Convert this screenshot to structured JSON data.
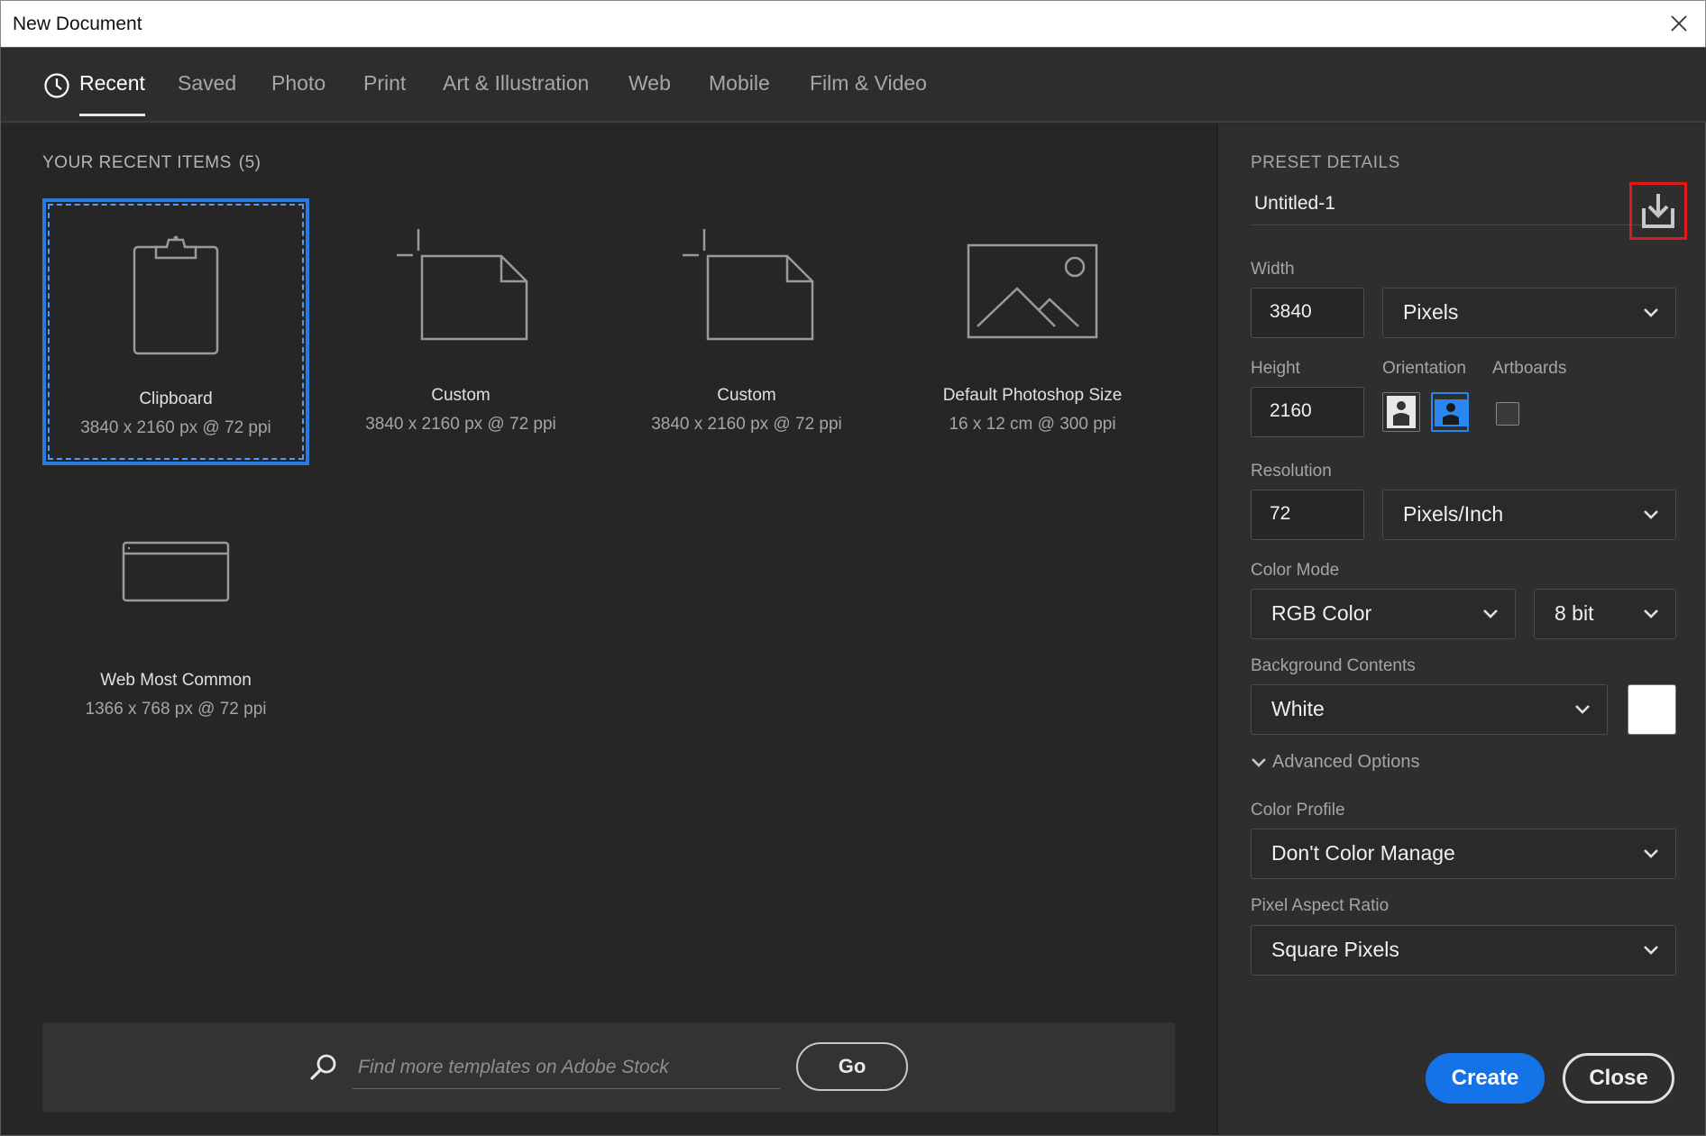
{
  "window": {
    "title": "New Document"
  },
  "tabs": [
    {
      "label": "Recent",
      "active": true
    },
    {
      "label": "Saved"
    },
    {
      "label": "Photo"
    },
    {
      "label": "Print"
    },
    {
      "label": "Art & Illustration"
    },
    {
      "label": "Web"
    },
    {
      "label": "Mobile"
    },
    {
      "label": "Film & Video"
    }
  ],
  "recent": {
    "title": "YOUR RECENT ITEMS",
    "count": "(5)",
    "items": [
      {
        "name": "Clipboard",
        "size": "3840 x 2160 px @ 72 ppi",
        "icon": "clipboard-icon",
        "selected": true
      },
      {
        "name": "Custom",
        "size": "3840 x 2160 px @ 72 ppi",
        "icon": "custom-doc-icon"
      },
      {
        "name": "Custom",
        "size": "3840 x 2160 px @ 72 ppi",
        "icon": "custom-doc-icon"
      },
      {
        "name": "Default Photoshop Size",
        "size": "16 x 12 cm @ 300 ppi",
        "icon": "image-icon"
      },
      {
        "name": "Web Most Common",
        "size": "1366 x 768 px @ 72 ppi",
        "icon": "browser-window-icon"
      }
    ]
  },
  "search": {
    "placeholder": "Find more templates on Adobe Stock",
    "go_label": "Go"
  },
  "preset": {
    "title": "PRESET DETAILS",
    "name": "Untitled-1",
    "width_label": "Width",
    "width": "3840",
    "width_unit": "Pixels",
    "height_label": "Height",
    "height": "2160",
    "orientation_label": "Orientation",
    "artboards_label": "Artboards",
    "resolution_label": "Resolution",
    "resolution": "72",
    "resolution_unit": "Pixels/Inch",
    "color_mode_label": "Color Mode",
    "color_mode": "RGB Color",
    "bit_depth": "8 bit",
    "background_label": "Background Contents",
    "background": "White",
    "background_color": "#ffffff",
    "advanced_label": "Advanced Options",
    "color_profile_label": "Color Profile",
    "color_profile": "Don't Color Manage",
    "pixel_aspect_label": "Pixel Aspect Ratio",
    "pixel_aspect": "Square Pixels"
  },
  "actions": {
    "create": "Create",
    "close": "Close"
  },
  "colors": {
    "accent": "#1473e6",
    "selection": "#2a7be0",
    "highlight": "#e01a1a"
  }
}
